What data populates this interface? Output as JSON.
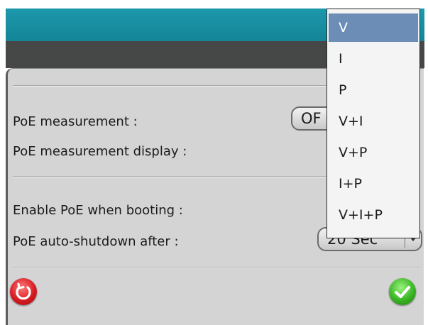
{
  "settings": {
    "poe_measurement_label": "PoE measurement :",
    "poe_measurement_value": "OF",
    "poe_measurement_display_label": "PoE measurement display :",
    "enable_poe_booting_label": "Enable PoE when booting :",
    "auto_shutdown_label": "PoE auto-shutdown after :",
    "auto_shutdown_value": "20 Sec"
  },
  "dropdown_menu": {
    "items": [
      "V",
      "I",
      "P",
      "V+I",
      "V+P",
      "I+P",
      "V+I+P"
    ],
    "selected_index": 0
  },
  "footer": {
    "reset_icon": "reset-icon",
    "confirm_icon": "checkmark-icon"
  },
  "colors": {
    "header_teal": "#1d98ab",
    "header_dark": "#454847",
    "dialog_bg": "#d4d4d4",
    "menu_selected": "#6b8db6",
    "reset_red": "#d81b22",
    "confirm_green": "#3ab524"
  }
}
